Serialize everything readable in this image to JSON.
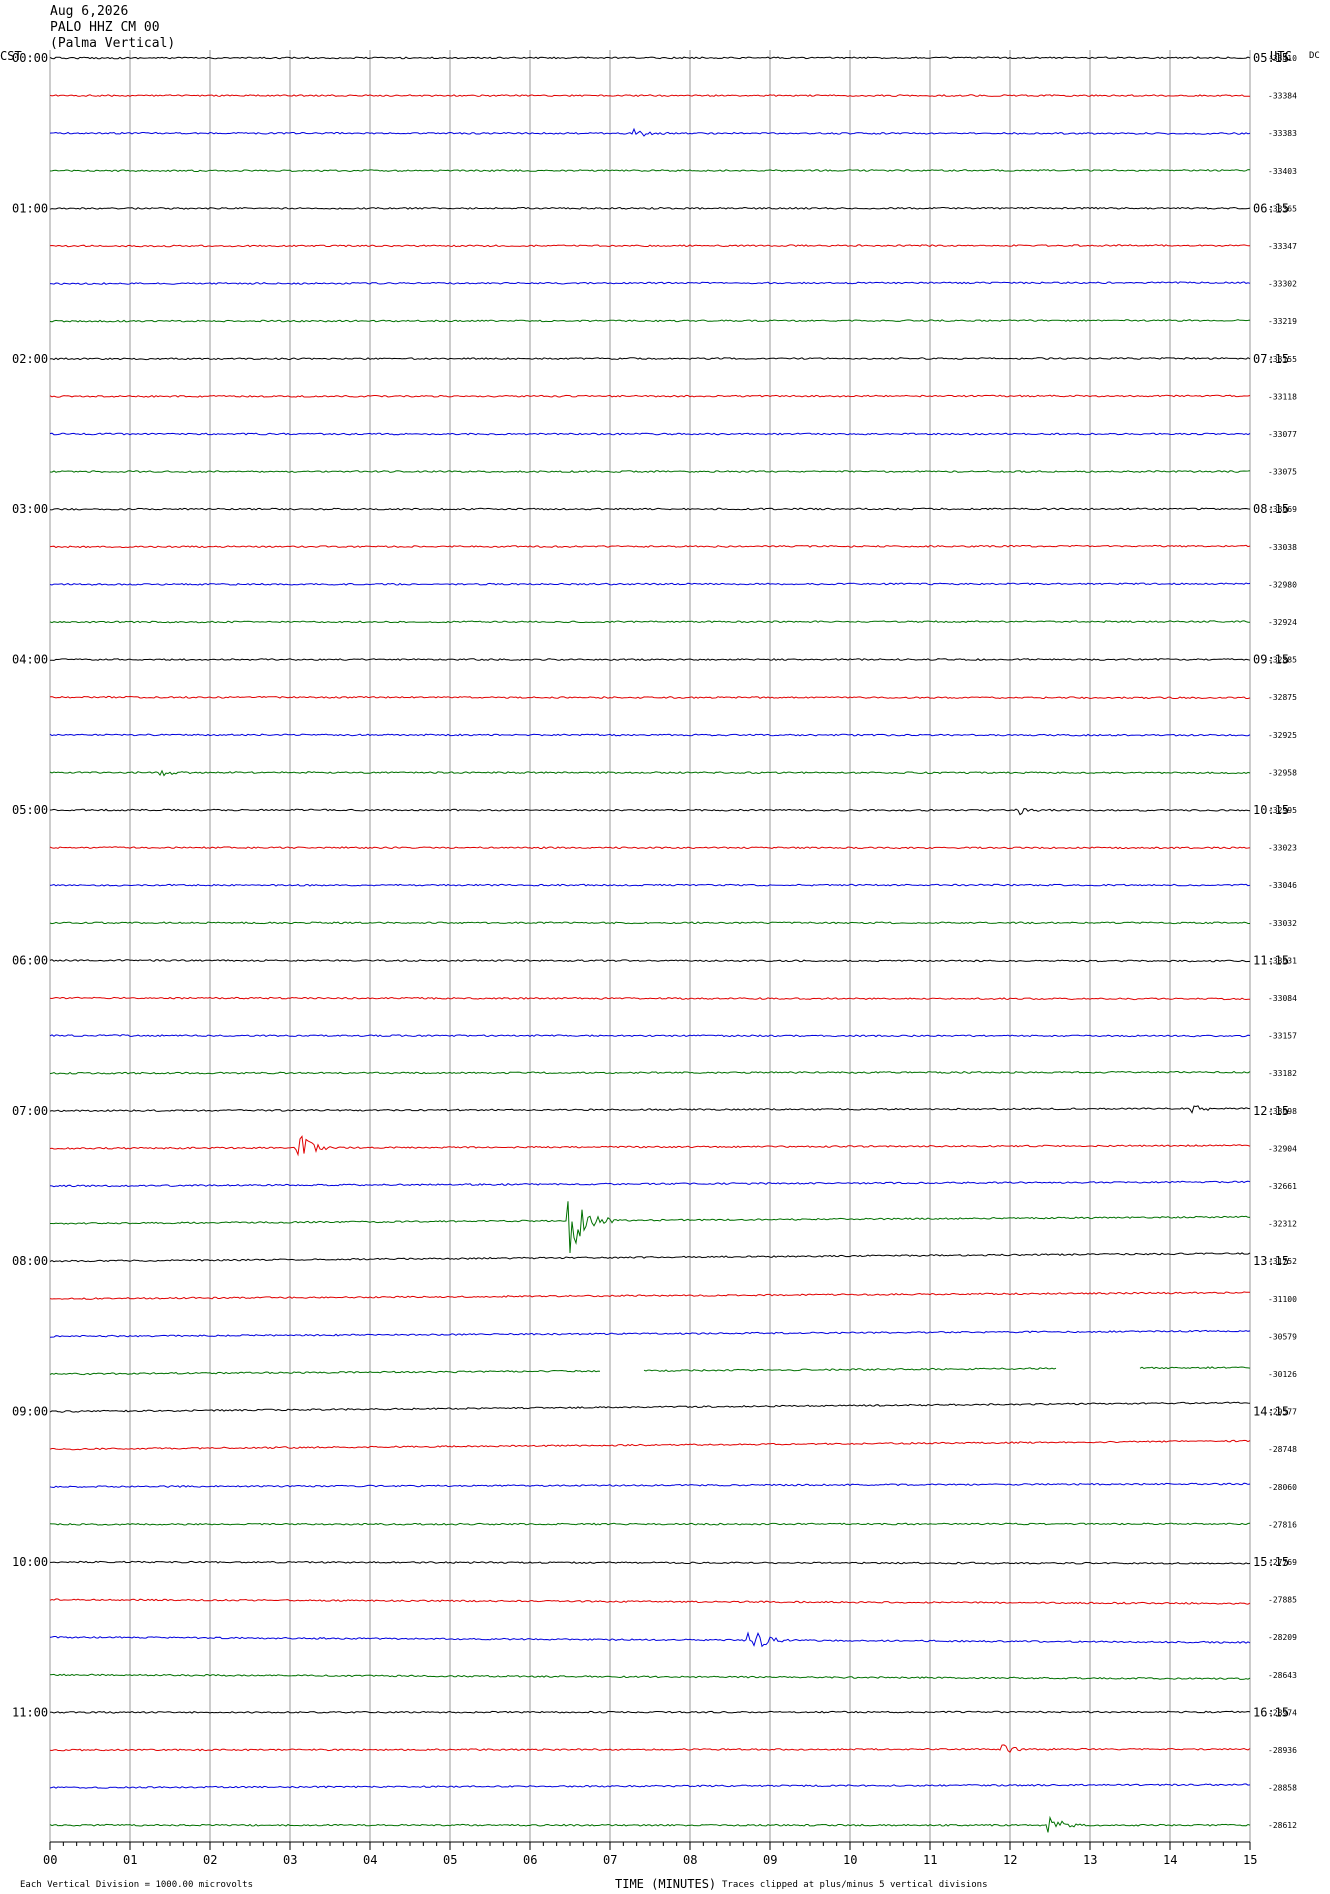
{
  "header": {
    "date": "Aug 6,2026",
    "station": "PALO HHZ CM 00",
    "site": "(Palma Vertical)"
  },
  "axes": {
    "left_tz": "CST",
    "right_tz": "UTC",
    "dc_label": "DC",
    "xlabel": "TIME (MINUTES)",
    "x_ticks": [
      "00",
      "01",
      "02",
      "03",
      "04",
      "05",
      "06",
      "07",
      "08",
      "09",
      "10",
      "11",
      "12",
      "13",
      "14",
      "15"
    ]
  },
  "footer": {
    "scale_note": "Each Vertical Division = 1000.00 microvolts",
    "clip_note": "Traces clipped at plus/minus 5 vertical divisions"
  },
  "colors": {
    "cycle": [
      "#000000",
      "#e00000",
      "#0000dd",
      "#007000"
    ],
    "grid": "#999999"
  },
  "chart_data": {
    "type": "line",
    "title": "PALO HHZ CM 00 (Palma Vertical) Aug 6,2026",
    "xlabel": "TIME (MINUTES)",
    "xlim": [
      0,
      15
    ],
    "traces_per_hour": 4,
    "minutes_per_trace": 15,
    "left_hour_labels": [
      "00:00",
      "01:00",
      "02:00",
      "03:00",
      "04:00",
      "05:00",
      "06:00",
      "07:00",
      "08:00",
      "09:00",
      "10:00",
      "11:00"
    ],
    "right_hour_labels": [
      "05:15",
      "06:15",
      "07:15",
      "08:15",
      "09:15",
      "10:15",
      "11:15",
      "12:15",
      "13:15",
      "14:15",
      "15:15",
      "16:15"
    ],
    "dc_offsets": [
      -33410,
      -33384,
      -33383,
      -33403,
      -33365,
      -33347,
      -33302,
      -33219,
      -33155,
      -33118,
      -33077,
      -33075,
      -33069,
      -33038,
      -32980,
      -32924,
      -32885,
      -32875,
      -32925,
      -32958,
      -32995,
      -33023,
      -33046,
      -33032,
      -33031,
      -33084,
      -33157,
      -33182,
      -33098,
      -32904,
      -32661,
      -32312,
      -31752,
      -31100,
      -30579,
      -30126,
      -29577,
      -28748,
      -28060,
      -27816,
      -27769,
      -27885,
      -28209,
      -28643,
      -28974,
      -28936,
      -28858,
      -28612
    ],
    "events": [
      {
        "trace": 2,
        "minute": 7.3,
        "amplitude": 0.3
      },
      {
        "trace": 19,
        "minute": 1.4,
        "amplitude": 0.2
      },
      {
        "trace": 20,
        "minute": 12.1,
        "amplitude": 0.3
      },
      {
        "trace": 28,
        "minute": 14.3,
        "amplitude": 0.3
      },
      {
        "trace": 29,
        "minute": 3.1,
        "amplitude": 1.0
      },
      {
        "trace": 31,
        "minute": 6.5,
        "amplitude": 2.5
      },
      {
        "trace": 42,
        "minute": 8.75,
        "amplitude": 1.1
      },
      {
        "trace": 45,
        "minute": 11.9,
        "amplitude": 0.4
      },
      {
        "trace": 47,
        "minute": 12.5,
        "amplitude": 0.5
      }
    ],
    "gaps": [
      {
        "trace": 35,
        "from_minute": 6.9,
        "to_minute": 7.4
      },
      {
        "trace": 35,
        "from_minute": 12.6,
        "to_minute": 13.6
      }
    ]
  }
}
